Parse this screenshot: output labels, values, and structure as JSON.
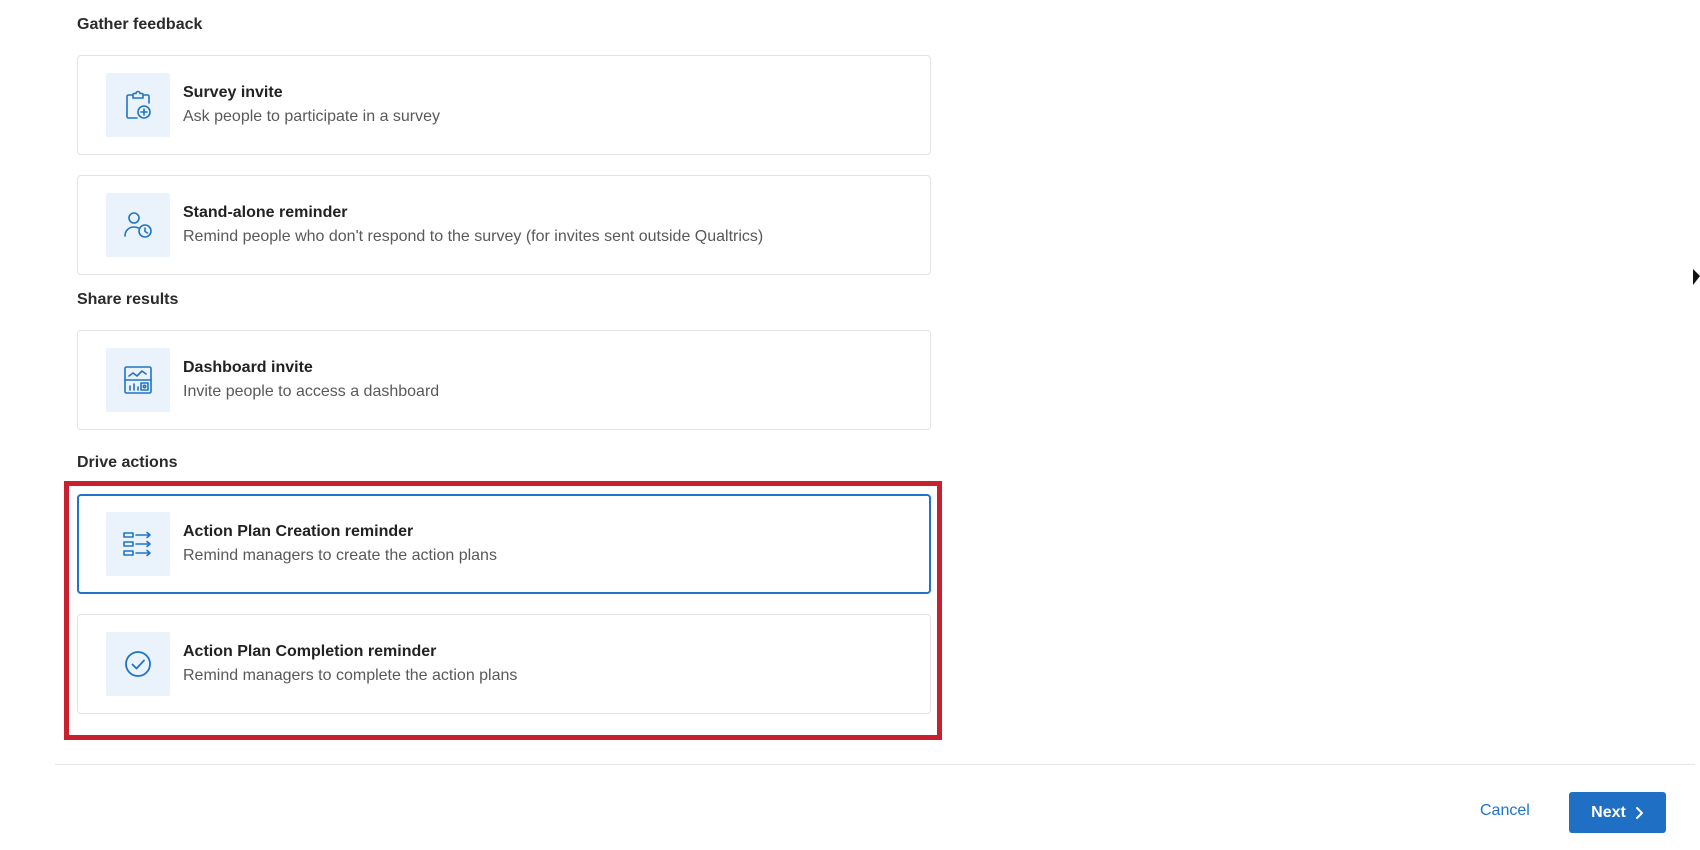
{
  "sections": {
    "gather_feedback": "Gather feedback",
    "share_results": "Share results",
    "drive_actions": "Drive actions"
  },
  "cards": {
    "survey_invite": {
      "title": "Survey invite",
      "description": "Ask people to participate in a survey",
      "icon": "clipboard-add-icon"
    },
    "standalone_reminder": {
      "title": "Stand-alone reminder",
      "description": "Remind people who don't respond to the survey (for invites sent outside Qualtrics)",
      "icon": "person-clock-icon"
    },
    "dashboard_invite": {
      "title": "Dashboard invite",
      "description": "Invite people to access a dashboard",
      "icon": "dashboard-icon"
    },
    "action_plan_creation": {
      "title": "Action Plan Creation reminder",
      "description": "Remind managers to create the action plans",
      "icon": "list-arrows-icon",
      "selected": true
    },
    "action_plan_completion": {
      "title": "Action Plan Completion reminder",
      "description": "Remind managers to complete the action plans",
      "icon": "check-circle-icon"
    }
  },
  "footer": {
    "cancel_label": "Cancel",
    "next_label": "Next"
  },
  "colors": {
    "accent": "#1f74c6",
    "highlight": "#c8202f",
    "icon_bg": "#eaf2fb"
  }
}
